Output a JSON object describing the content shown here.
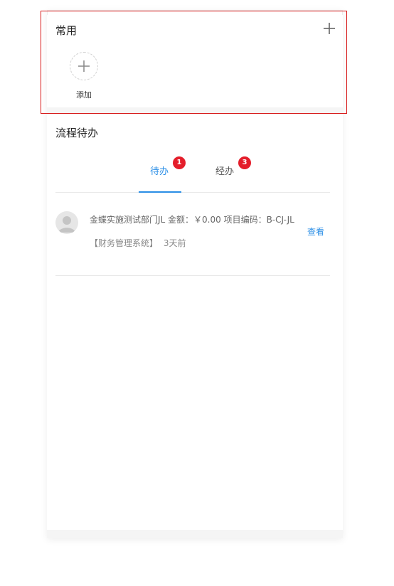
{
  "common": {
    "title": "常用",
    "add_label": "添加"
  },
  "todo": {
    "title": "流程待办",
    "tabs": [
      {
        "label": "待办",
        "badge": "1",
        "active": true
      },
      {
        "label": "经办",
        "badge": "3",
        "active": false
      }
    ],
    "items": [
      {
        "summary": "金蝶实施测试部门JL 金额：￥0.00 项目编码：B-CJ-JL",
        "action": "查看",
        "source": "【财务管理系统】",
        "time": "3天前"
      }
    ]
  },
  "colors": {
    "accent": "#2a8ee6",
    "badge": "#e41e2b",
    "highlight_border": "#d71a1a"
  }
}
